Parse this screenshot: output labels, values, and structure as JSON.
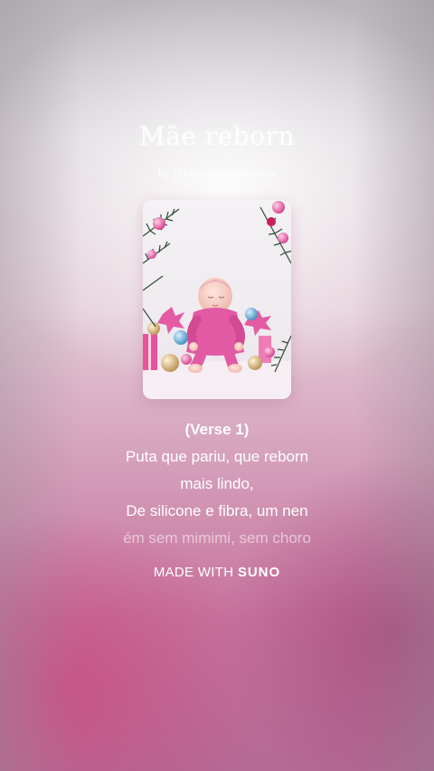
{
  "song": {
    "title": "Mãe reborn",
    "byline": "by @radicalheadlineicex"
  },
  "cover": {
    "image": "baby-doll-christmas-cover",
    "colors": {
      "outfit": "#e25aa4",
      "background": "#f2eef2"
    }
  },
  "lyrics": {
    "section": "(Verse 1)",
    "lines": [
      "Puta que pariu, que reborn",
      "mais lindo,",
      "De silicone e fibra, um nen",
      "ém sem mimimi, sem choro"
    ]
  },
  "footer": {
    "made_with": "MADE WITH",
    "brand": "SUNO"
  }
}
